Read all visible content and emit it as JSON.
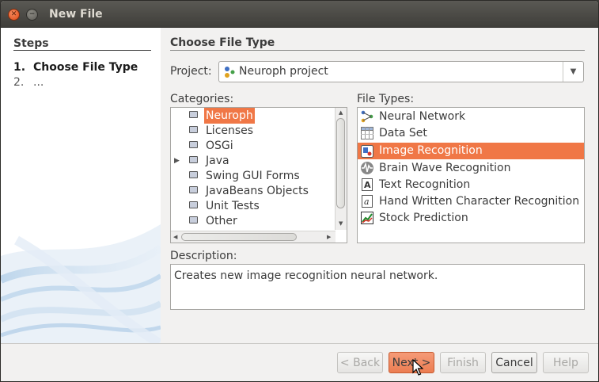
{
  "window": {
    "title": "New File"
  },
  "steps": {
    "heading": "Steps",
    "items": [
      {
        "num": "1.",
        "label": "Choose File Type",
        "active": true
      },
      {
        "num": "2.",
        "label": "...",
        "active": false
      }
    ]
  },
  "main": {
    "title": "Choose File Type",
    "project_label": "Project:",
    "project_value": "Neuroph project",
    "categories_label": "Categories:",
    "file_types_label": "File Types:",
    "description_label": "Description:",
    "description_text": "Creates new image recognition neural network."
  },
  "categories": [
    {
      "label": "Neuroph",
      "selected": true,
      "expander": false
    },
    {
      "label": "Licenses",
      "selected": false,
      "expander": false
    },
    {
      "label": "OSGi",
      "selected": false,
      "expander": false
    },
    {
      "label": "Java",
      "selected": false,
      "expander": true
    },
    {
      "label": "Swing GUI Forms",
      "selected": false,
      "expander": false
    },
    {
      "label": "JavaBeans Objects",
      "selected": false,
      "expander": false
    },
    {
      "label": "Unit Tests",
      "selected": false,
      "expander": false
    },
    {
      "label": "Other",
      "selected": false,
      "expander": false
    }
  ],
  "file_types": [
    {
      "label": "Neural Network",
      "icon": "neural-network-icon",
      "selected": false
    },
    {
      "label": "Data Set",
      "icon": "data-set-icon",
      "selected": false
    },
    {
      "label": "Image Recognition",
      "icon": "image-recognition-icon",
      "selected": true
    },
    {
      "label": "Brain Wave Recognition",
      "icon": "brain-wave-icon",
      "selected": false
    },
    {
      "label": "Text Recognition",
      "icon": "text-recognition-icon",
      "selected": false
    },
    {
      "label": "Hand Written Character Recognition",
      "icon": "handwriting-icon",
      "selected": false
    },
    {
      "label": "Stock Prediction",
      "icon": "stock-chart-icon",
      "selected": false
    }
  ],
  "buttons": {
    "back": "< Back",
    "next": "Next >",
    "finish": "Finish",
    "cancel": "Cancel",
    "help": "Help"
  },
  "colors": {
    "selection": "#f07746",
    "accent_button": "#ec7d52"
  }
}
